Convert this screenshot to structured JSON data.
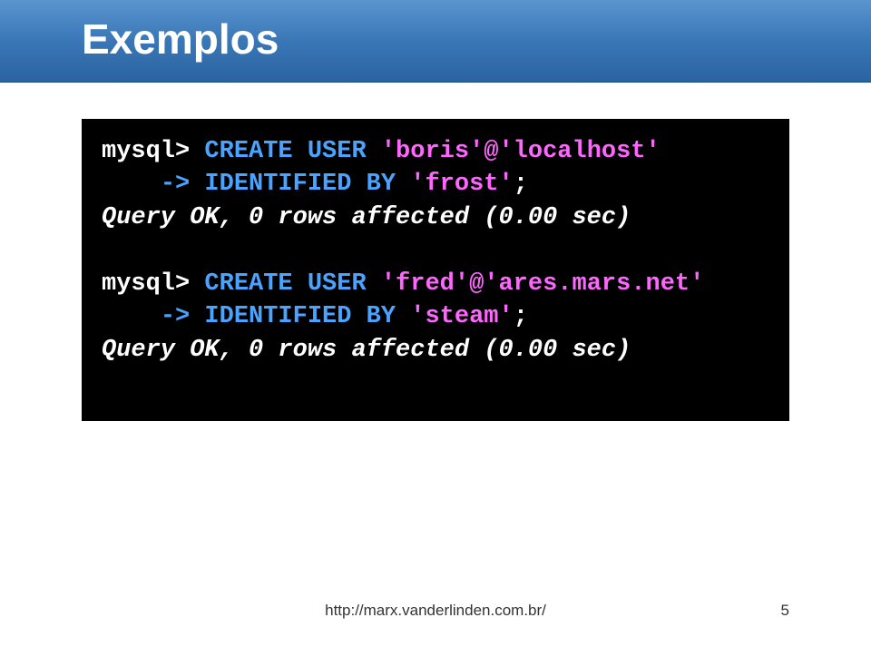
{
  "header": {
    "title": "Exemplos"
  },
  "code": {
    "l1_prompt": "mysql> ",
    "l1_kw": "CREATE USER ",
    "l1_str": "'boris'@'localhost'",
    "l2_cont": "    -> ",
    "l2_kw": "IDENTIFIED BY ",
    "l2_str": "'frost'",
    "l2_semi": ";",
    "l3_res": "Query OK, 0 rows affected (0.00 sec)",
    "l4_prompt": "mysql> ",
    "l4_kw": "CREATE USER ",
    "l4_str": "'fred'@'ares.mars.net'",
    "l5_cont": "    -> ",
    "l5_kw": "IDENTIFIED BY ",
    "l5_str": "'steam'",
    "l5_semi": ";",
    "l6_res": "Query OK, 0 rows affected (0.00 sec)"
  },
  "footer": {
    "url": "http://marx.vanderlinden.com.br/",
    "page": "5"
  }
}
